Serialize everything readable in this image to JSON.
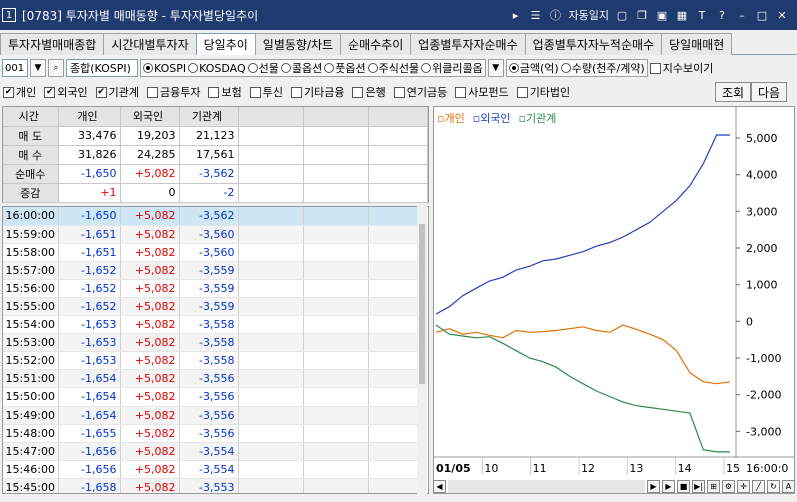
{
  "window": {
    "number": "1",
    "title": "[0783] 투자자별 매매동향 - 투자자별당일추이",
    "auto_journal": "자동일지"
  },
  "tabs": [
    {
      "label": "투자자별매매종합"
    },
    {
      "label": "시간대별투자자"
    },
    {
      "label": "당일추이",
      "active": true
    },
    {
      "label": "일별동향/차트"
    },
    {
      "label": "순매수추이"
    },
    {
      "label": "업종별투자자순매수"
    },
    {
      "label": "업종별투자자누적순매수"
    },
    {
      "label": "당일매매현"
    }
  ],
  "filter": {
    "code": "001",
    "name": "종합(KOSPI)",
    "markets": [
      {
        "label": "KOSPI",
        "on": true
      },
      {
        "label": "KOSDAQ",
        "on": false
      },
      {
        "label": "선물",
        "on": false
      },
      {
        "label": "콜옵션",
        "on": false
      },
      {
        "label": "풋옵션",
        "on": false
      },
      {
        "label": "주식선물",
        "on": false
      },
      {
        "label": "위클리콜옵",
        "on": false
      }
    ],
    "units": [
      {
        "label": "금액(억)",
        "on": true
      },
      {
        "label": "수량(천주/계약)",
        "on": false
      }
    ],
    "index_show": "지수보이기"
  },
  "investors": [
    {
      "label": "개인",
      "checked": true
    },
    {
      "label": "외국인",
      "checked": true
    },
    {
      "label": "기관계",
      "checked": true
    },
    {
      "label": "금융투자",
      "checked": false
    },
    {
      "label": "보험",
      "checked": false
    },
    {
      "label": "투신",
      "checked": false
    },
    {
      "label": "기타금융",
      "checked": false
    },
    {
      "label": "은행",
      "checked": false
    },
    {
      "label": "연기금등",
      "checked": false
    },
    {
      "label": "사모펀드",
      "checked": false
    },
    {
      "label": "기타법인",
      "checked": false
    }
  ],
  "buttons": {
    "query": "조회",
    "next": "다음"
  },
  "summary": {
    "headers": [
      "시간",
      "개인",
      "외국인",
      "기관계"
    ],
    "rows": [
      {
        "label": "매 도",
        "values": [
          "33,476",
          "19,203",
          "21,123"
        ],
        "cls": [
          "",
          "",
          ""
        ]
      },
      {
        "label": "매 수",
        "values": [
          "31,826",
          "24,285",
          "17,561"
        ],
        "cls": [
          "",
          "",
          ""
        ]
      },
      {
        "label": "순매수",
        "values": [
          "-1,650",
          "+5,082",
          "-3,562"
        ],
        "cls": [
          "neg",
          "pos",
          "neg"
        ]
      },
      {
        "label": "증감",
        "values": [
          "+1",
          "0",
          "-2"
        ],
        "cls": [
          "pos",
          "",
          "neg"
        ]
      }
    ]
  },
  "timeseries": [
    {
      "time": "16:00:00",
      "v": [
        "-1,650",
        "+5,082",
        "-3,562"
      ]
    },
    {
      "time": "15:59:00",
      "v": [
        "-1,651",
        "+5,082",
        "-3,560"
      ]
    },
    {
      "time": "15:58:00",
      "v": [
        "-1,651",
        "+5,082",
        "-3,560"
      ]
    },
    {
      "time": "15:57:00",
      "v": [
        "-1,652",
        "+5,082",
        "-3,559"
      ]
    },
    {
      "time": "15:56:00",
      "v": [
        "-1,652",
        "+5,082",
        "-3,559"
      ]
    },
    {
      "time": "15:55:00",
      "v": [
        "-1,652",
        "+5,082",
        "-3,559"
      ]
    },
    {
      "time": "15:54:00",
      "v": [
        "-1,653",
        "+5,082",
        "-3,558"
      ]
    },
    {
      "time": "15:53:00",
      "v": [
        "-1,653",
        "+5,082",
        "-3,558"
      ]
    },
    {
      "time": "15:52:00",
      "v": [
        "-1,653",
        "+5,082",
        "-3,558"
      ]
    },
    {
      "time": "15:51:00",
      "v": [
        "-1,654",
        "+5,082",
        "-3,556"
      ]
    },
    {
      "time": "15:50:00",
      "v": [
        "-1,654",
        "+5,082",
        "-3,556"
      ]
    },
    {
      "time": "15:49:00",
      "v": [
        "-1,654",
        "+5,082",
        "-3,556"
      ]
    },
    {
      "time": "15:48:00",
      "v": [
        "-1,655",
        "+5,082",
        "-3,556"
      ]
    },
    {
      "time": "15:47:00",
      "v": [
        "-1,656",
        "+5,082",
        "-3,554"
      ]
    },
    {
      "time": "15:46:00",
      "v": [
        "-1,656",
        "+5,082",
        "-3,554"
      ]
    },
    {
      "time": "15:45:00",
      "v": [
        "-1,658",
        "+5,082",
        "-3,553"
      ]
    }
  ],
  "chart_data": {
    "type": "line",
    "x_ticks": [
      "01/05",
      "10",
      "11",
      "12",
      "13",
      "14",
      "15",
      "16:00:0"
    ],
    "y_ticks": [
      "5,000",
      "4,000",
      "3,000",
      "2,000",
      "1,000",
      "0",
      "-1,000",
      "-2,000",
      "-3,000"
    ],
    "ylim": [
      -3700,
      5300
    ],
    "series": [
      {
        "name": "개인",
        "color": "#e07000",
        "values": [
          -300,
          -200,
          -350,
          -300,
          -380,
          -450,
          -250,
          -300,
          -280,
          -250,
          -200,
          -150,
          -250,
          -300,
          -100,
          -220,
          -350,
          -500,
          -800,
          -1400,
          -1650,
          -1700,
          -1650
        ]
      },
      {
        "name": "외국인",
        "color": "#1f3fbf",
        "values": [
          200,
          400,
          700,
          900,
          1100,
          1200,
          1400,
          1500,
          1650,
          1700,
          1800,
          1900,
          2050,
          2150,
          2300,
          2500,
          2700,
          3000,
          3300,
          3700,
          4300,
          5082,
          5082
        ]
      },
      {
        "name": "기관계",
        "color": "#2a8a4a",
        "values": [
          -100,
          -350,
          -400,
          -450,
          -420,
          -600,
          -800,
          -1000,
          -1100,
          -1250,
          -1500,
          -1700,
          -1900,
          -2050,
          -2200,
          -2300,
          -2350,
          -2400,
          -2450,
          -2500,
          -3500,
          -3562,
          -3562
        ]
      }
    ]
  }
}
